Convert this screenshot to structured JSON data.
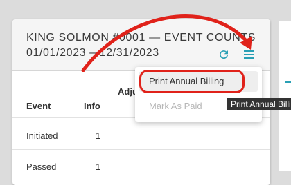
{
  "card": {
    "title_line1": "KING SOLMON #0001 — EVENT COUNTS",
    "title_line2": "01/01/2023 – 12/31/2023",
    "refresh_icon": "refresh-icon",
    "menu_icon": "hamburger-menu-icon",
    "accent_color": "#2aa0b5"
  },
  "table": {
    "headers": {
      "event": "Event",
      "info": "Info",
      "adjustments": "Adju"
    },
    "rows": [
      {
        "event": "Initiated",
        "info": "1"
      },
      {
        "event": "Passed",
        "info": "1"
      }
    ]
  },
  "menu": {
    "items": [
      {
        "label": "Print Annual Billing",
        "state": "hover"
      },
      {
        "label": "Mark As Paid",
        "state": "disabled"
      }
    ]
  },
  "tooltip": {
    "text": "Print Annual Billing"
  },
  "annotation": {
    "color": "#e0221a"
  }
}
